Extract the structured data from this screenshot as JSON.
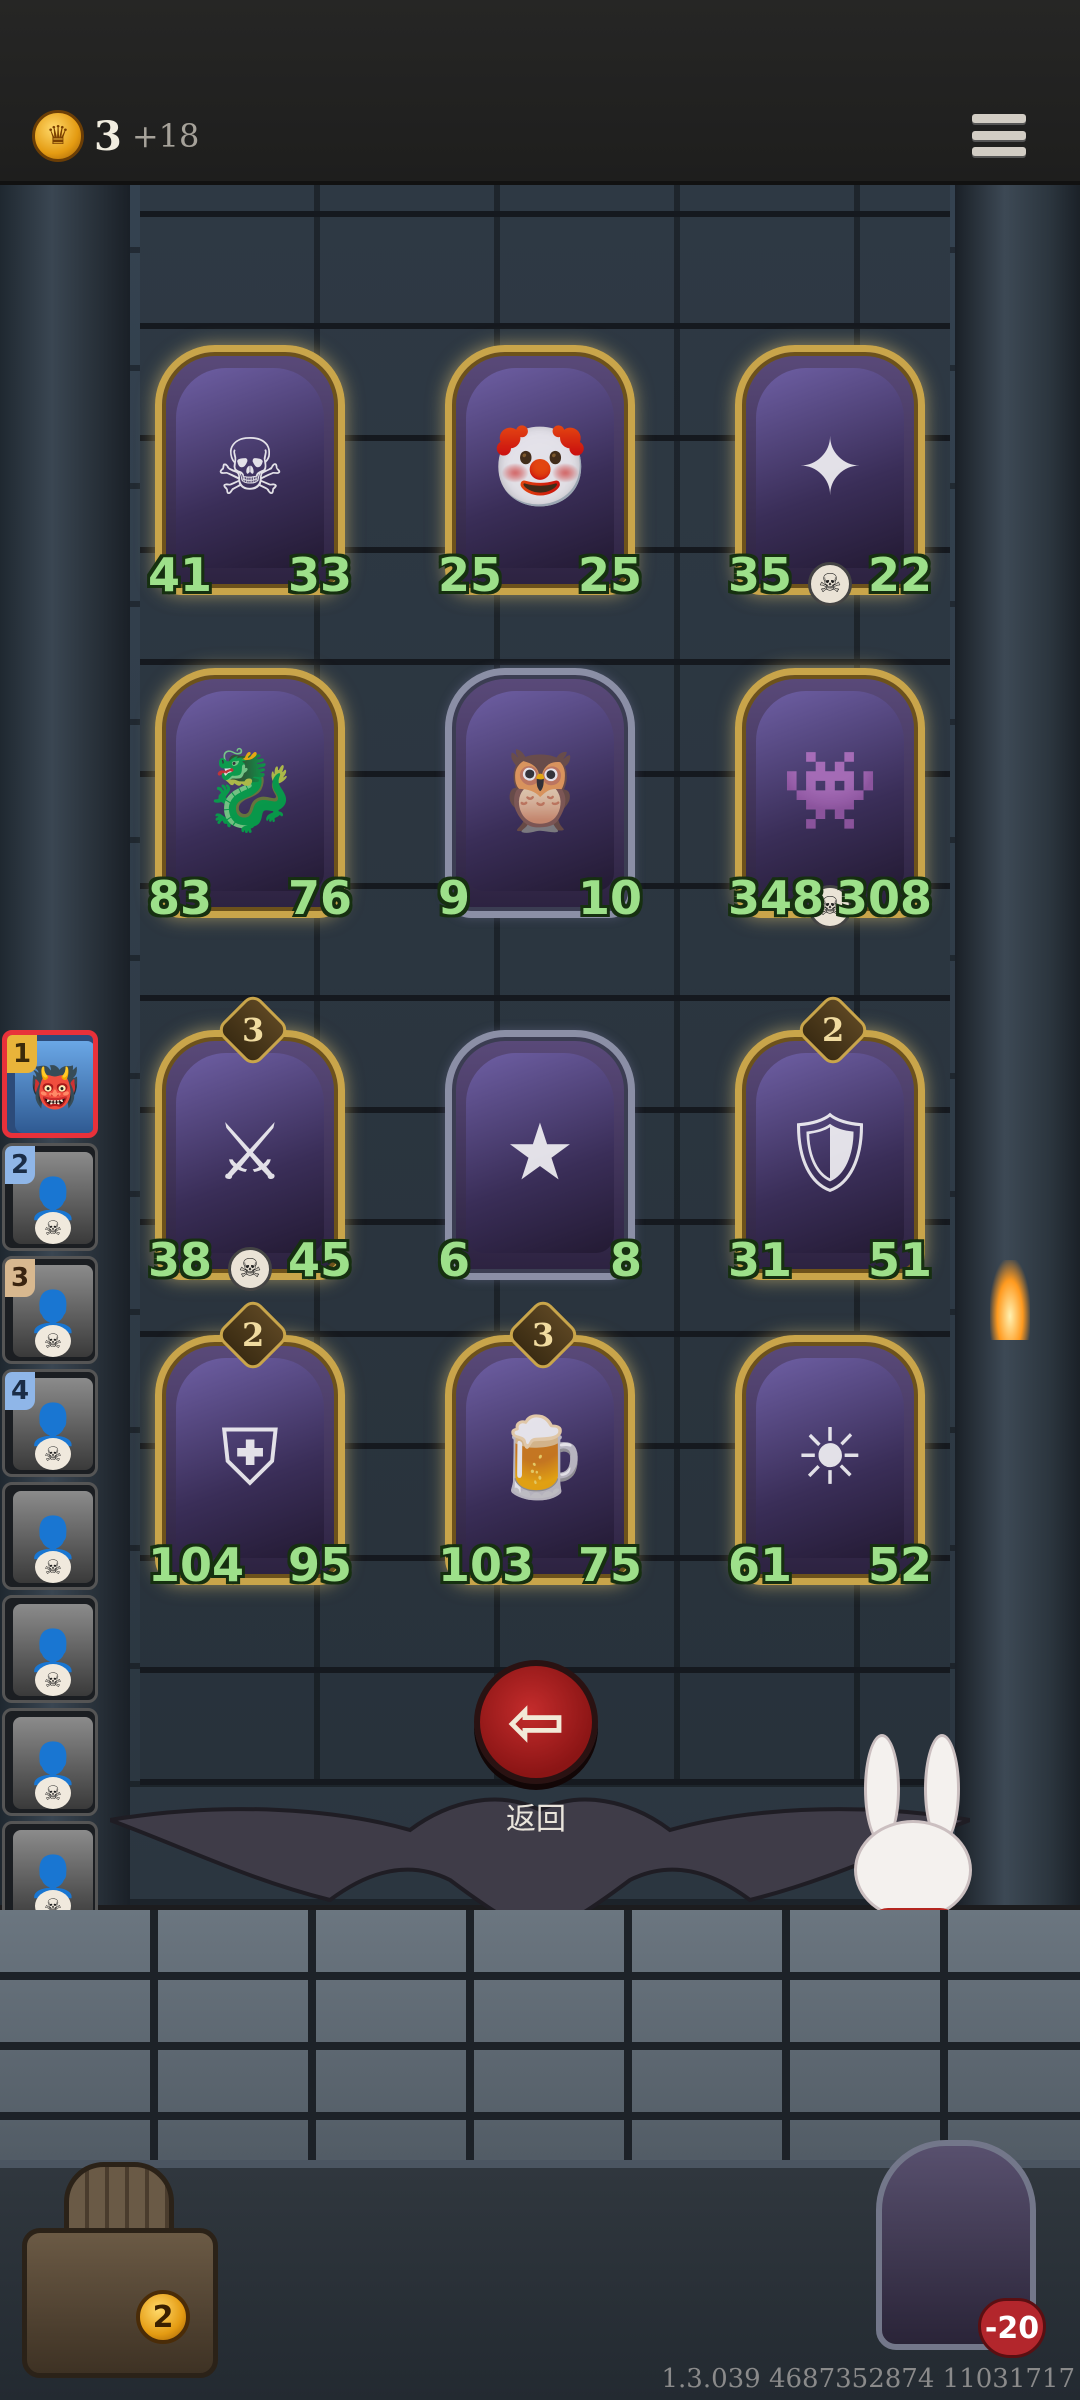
{
  "header": {
    "gold_icon": "coin-icon",
    "gold_count": "3",
    "gold_income": "+18",
    "menu_icon": "menu-icon"
  },
  "board": {
    "cards": [
      {
        "atk": "41",
        "hp": "33",
        "level": "",
        "skull": false,
        "frame": "gold",
        "icon": "☠"
      },
      {
        "atk": "25",
        "hp": "25",
        "level": "",
        "skull": false,
        "frame": "gold",
        "icon": "🤡"
      },
      {
        "atk": "35",
        "hp": "22",
        "level": "",
        "skull": true,
        "frame": "gold",
        "icon": "✦"
      },
      {
        "atk": "83",
        "hp": "76",
        "level": "",
        "skull": false,
        "frame": "gold",
        "icon": "🐉"
      },
      {
        "atk": "9",
        "hp": "10",
        "level": "",
        "skull": false,
        "frame": "silver",
        "icon": "🦉"
      },
      {
        "atk": "348",
        "hp": "308",
        "level": "",
        "skull": true,
        "frame": "gold",
        "icon": "👾"
      },
      {
        "atk": "38",
        "hp": "45",
        "level": "3",
        "skull": true,
        "frame": "gold",
        "icon": "⚔"
      },
      {
        "atk": "6",
        "hp": "8",
        "level": "",
        "skull": false,
        "frame": "silver",
        "icon": "★"
      },
      {
        "atk": "31",
        "hp": "51",
        "level": "2",
        "skull": false,
        "frame": "gold",
        "icon": "🛡"
      },
      {
        "atk": "104",
        "hp": "95",
        "level": "2",
        "skull": false,
        "frame": "gold",
        "icon": "⛨"
      },
      {
        "atk": "103",
        "hp": "75",
        "level": "3",
        "skull": false,
        "frame": "gold",
        "icon": "🍺"
      },
      {
        "atk": "61",
        "hp": "52",
        "level": "",
        "skull": false,
        "frame": "gold",
        "icon": "☀"
      }
    ]
  },
  "queue": [
    {
      "num": "1",
      "style": "gold",
      "active": true,
      "skull": false
    },
    {
      "num": "2",
      "style": "blue",
      "active": false,
      "skull": true
    },
    {
      "num": "3",
      "style": "tan",
      "active": false,
      "skull": true
    },
    {
      "num": "4",
      "style": "blue",
      "active": false,
      "skull": true
    },
    {
      "num": "",
      "style": "",
      "active": false,
      "skull": true
    },
    {
      "num": "",
      "style": "",
      "active": false,
      "skull": true
    },
    {
      "num": "",
      "style": "",
      "active": false,
      "skull": true
    },
    {
      "num": "",
      "style": "",
      "active": false,
      "skull": true
    }
  ],
  "back_button": {
    "label": "返回",
    "icon": "arrow-left-icon"
  },
  "chest": {
    "count": "2",
    "icon": "treasure-chest-icon"
  },
  "hero": {
    "health": "-20",
    "icon": "heart-icon"
  },
  "version": "1.3.039 4687352874 11031717",
  "colors": {
    "stat_green": "#9de08a",
    "gold_frame": "#c9a54a",
    "silver_frame": "#8b8fa6",
    "back_red": "#c42c2c"
  }
}
